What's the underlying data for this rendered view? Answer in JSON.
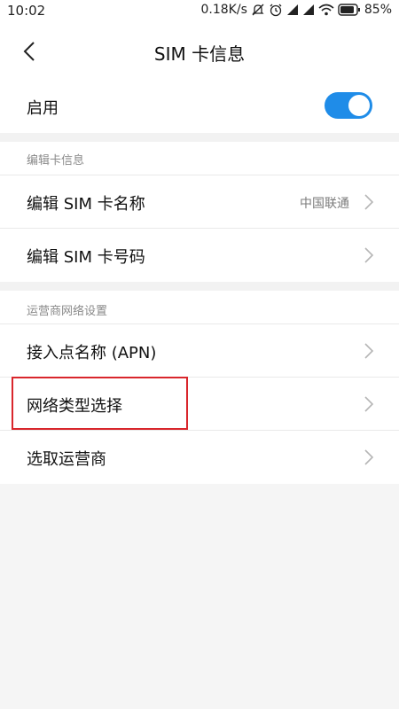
{
  "status_bar": {
    "time": "10:02",
    "network_speed": "0.18K/s",
    "battery_percent": "85%",
    "icons": [
      "mute-icon",
      "alarm-icon",
      "signal-icon",
      "signal-icon",
      "wifi-icon",
      "battery-icon"
    ]
  },
  "header": {
    "title": "SIM  卡信息",
    "back_icon": "chevron-left-icon"
  },
  "enable_row": {
    "label": "启用",
    "toggle_on": true,
    "toggle_color": "#1f8ce8"
  },
  "edit_section": {
    "header": "编辑卡信息",
    "items": [
      {
        "label": "编辑 SIM 卡名称",
        "value": "中国联通"
      },
      {
        "label": "编辑 SIM 卡号码",
        "value": ""
      }
    ]
  },
  "network_section": {
    "header": "运营商网络设置",
    "items": [
      {
        "label": "接入点名称 (APN)"
      },
      {
        "label": "网络类型选择",
        "highlighted": true
      },
      {
        "label": "选取运营商"
      }
    ]
  },
  "colors": {
    "highlight": "#d9262c",
    "background": "#f5f5f5"
  }
}
